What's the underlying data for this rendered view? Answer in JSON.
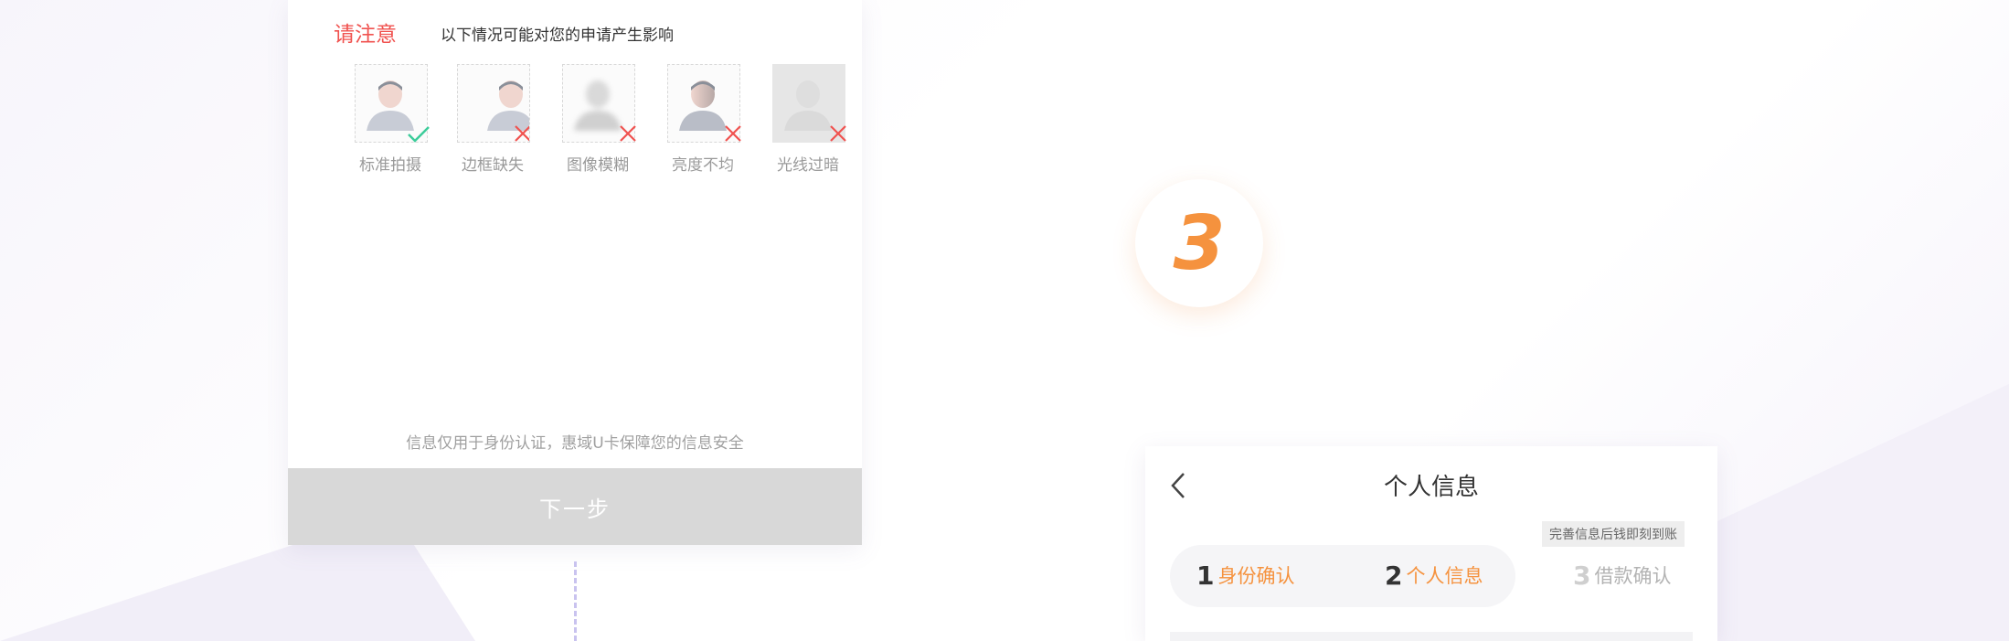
{
  "notice": {
    "title": "请注意",
    "subtitle": "以下情况可能对您的申请产生影响",
    "samples": [
      {
        "label": "标准拍摄",
        "status": "ok"
      },
      {
        "label": "边框缺失",
        "status": "bad"
      },
      {
        "label": "图像模糊",
        "status": "bad"
      },
      {
        "label": "亮度不均",
        "status": "bad"
      },
      {
        "label": "光线过暗",
        "status": "bad"
      }
    ]
  },
  "footer": {
    "note": "信息仅用于身份认证，惠域U卡保障您的信息安全",
    "next_label": "下一步"
  },
  "step_marker": "3",
  "personal_info": {
    "title": "个人信息",
    "promo": "完善信息后钱即刻到账",
    "steps": [
      {
        "num": "1",
        "label": "身份确认"
      },
      {
        "num": "2",
        "label": "个人信息"
      },
      {
        "num": "3",
        "label": "借款确认"
      }
    ]
  },
  "colors": {
    "accent": "#f5923e",
    "warning": "#f0524f",
    "ok": "#3ccc9a",
    "button_disabled": "#d8d8d8"
  },
  "icons": {
    "ok_mark": "check-icon",
    "bad_mark": "cross-icon",
    "back": "chevron-left-icon"
  }
}
